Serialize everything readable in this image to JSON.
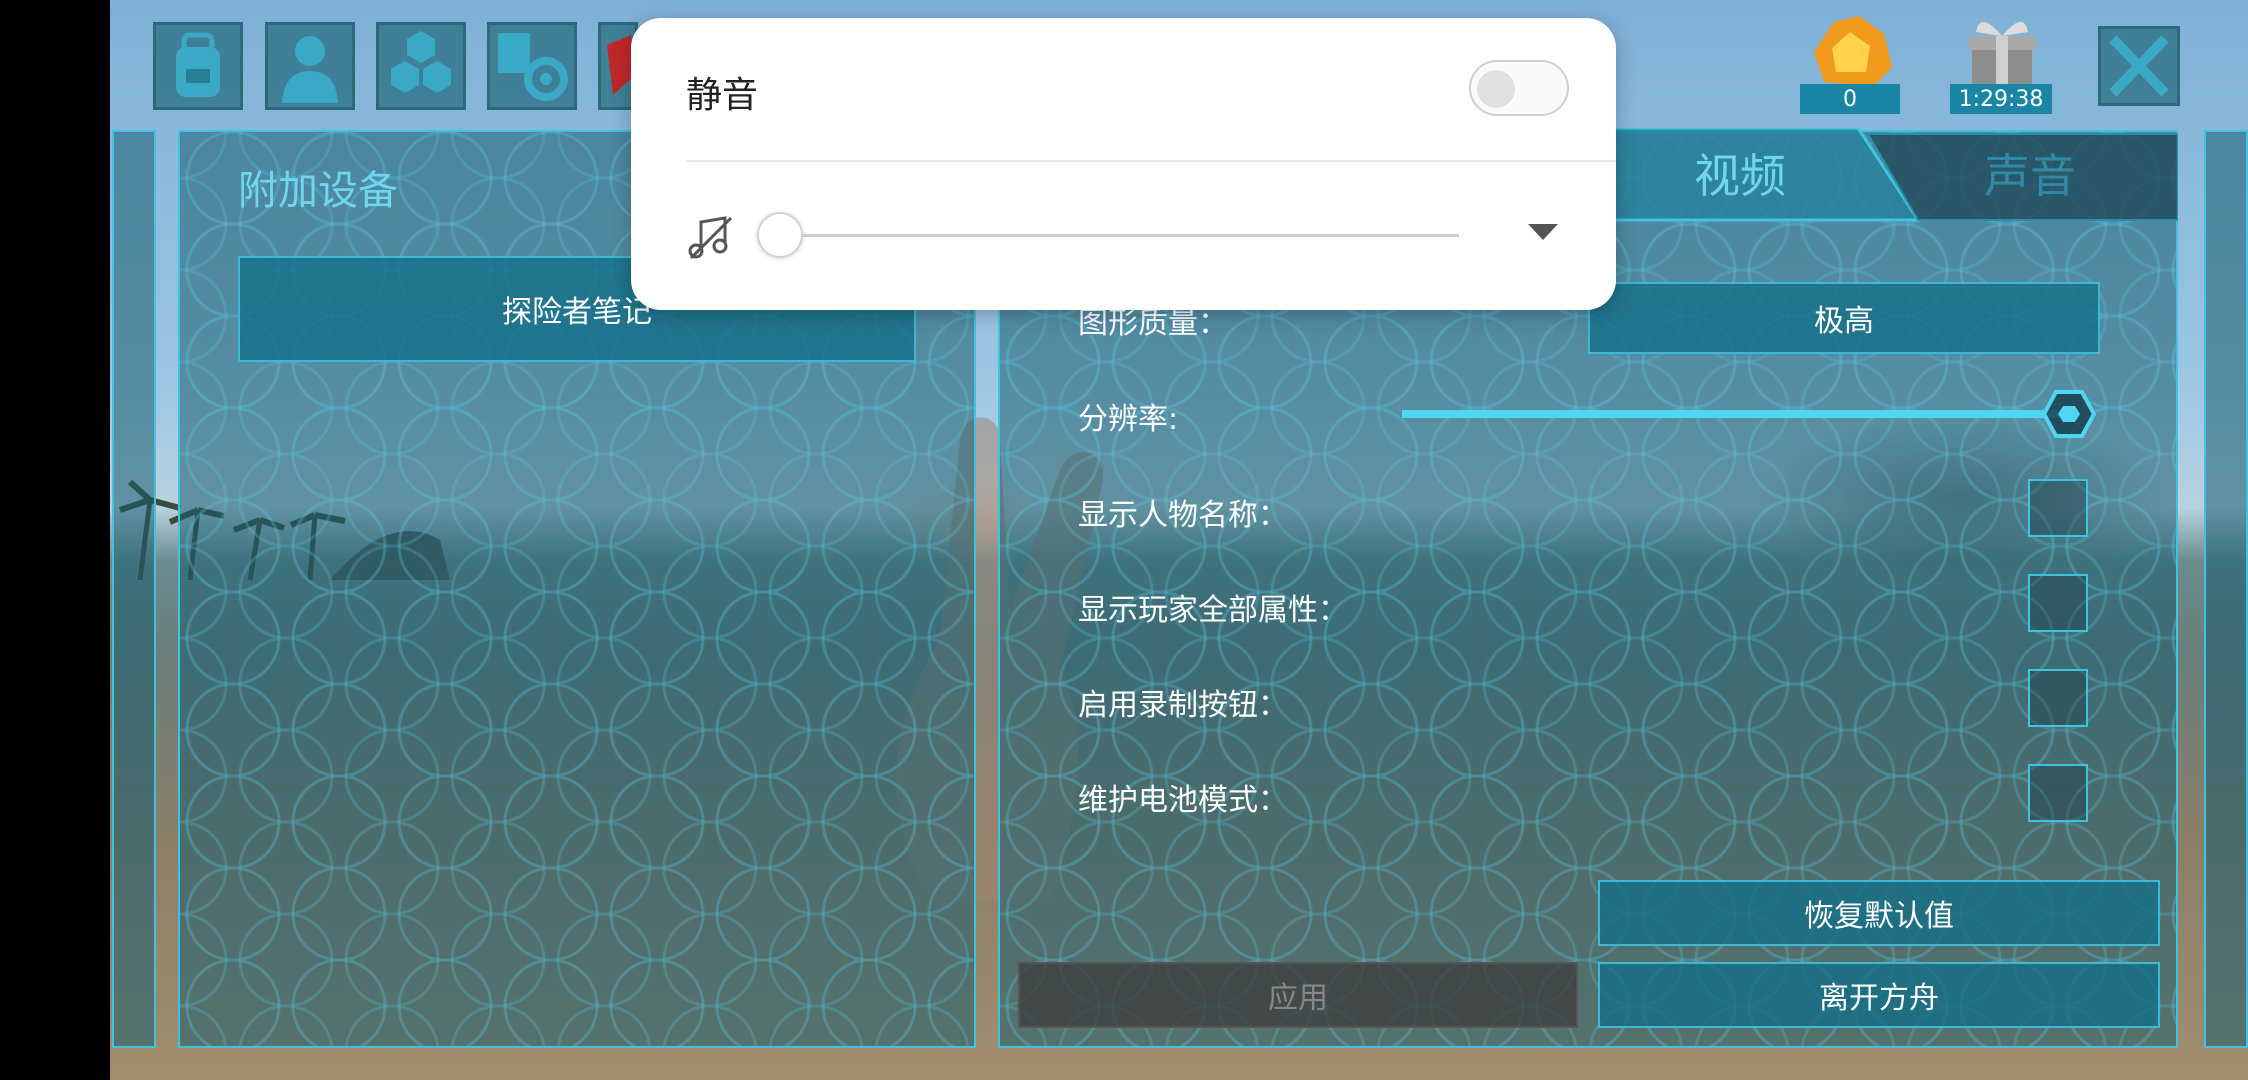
{
  "popup": {
    "mute_label": "静音",
    "mute_enabled": false,
    "volume_level": 0
  },
  "hud": {
    "currency_count": "0",
    "gift_timer": "1:29:38",
    "close_icon": "close-icon"
  },
  "left_panel": {
    "title": "附加设备",
    "explorer_notes_button": "探险者笔记"
  },
  "tabs": [
    {
      "label": "视频",
      "active": true
    },
    {
      "label": "声音",
      "active": false
    }
  ],
  "settings": {
    "graphics_quality_label": "图形质量：",
    "graphics_quality_value": "极高",
    "resolution_label": "分辨率:",
    "resolution_level": 1.0,
    "show_character_names_label": "显示人物名称：",
    "show_all_player_stats_label": "显示玩家全部属性：",
    "enable_record_button_label": "启用录制按钮：",
    "battery_saver_mode_label": "维护电池模式："
  },
  "buttons": {
    "restore_defaults": "恢复默认值",
    "apply": "应用",
    "leave_ark": "离开方舟"
  },
  "colors": {
    "accent": "#6fd6ee",
    "panel_border": "#3fc3df",
    "button_bg": "#146e87"
  }
}
